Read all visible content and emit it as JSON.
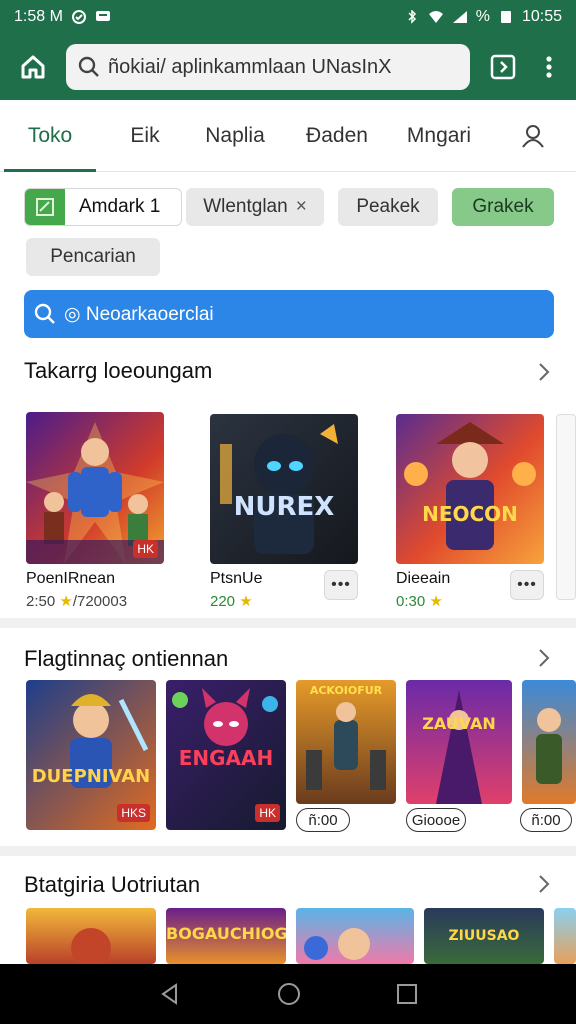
{
  "status_bar": {
    "time_left": "1:58 M",
    "time_right": "10:55",
    "battery": "%"
  },
  "app_bar": {
    "search_text": "ñokiai/ aplinkammlaan UNasInX",
    "home_icon": "home-icon",
    "tabs_icon": "tabs-icon",
    "menu_icon": "more-vertical-icon",
    "color": "#1f6f4a"
  },
  "nav_tabs": [
    {
      "label": "Toko",
      "active": true
    },
    {
      "label": "Eik",
      "active": false
    },
    {
      "label": "Naplia",
      "active": false
    },
    {
      "label": "Ðaden",
      "active": false
    },
    {
      "label": "Mngari",
      "active": false
    }
  ],
  "filter_chips": {
    "first": "Amdark 1",
    "second": "Wlentglan",
    "second_close": "×",
    "third": "Peakek",
    "fourth": "Grakek",
    "fifth": "Pencarian"
  },
  "search_banner": {
    "text": "◎ Neoarkaoerclai"
  },
  "section1": {
    "title": "Takarrg loeoungam",
    "cards": [
      {
        "name": "PoenIRnean",
        "meta": "2:50",
        "rating_text": "/720003",
        "badge": "HK"
      },
      {
        "name": "PtsnUe",
        "meta": "220",
        "art_text": "NUREX"
      },
      {
        "name": "Dieeain",
        "meta": "0:30",
        "art_text": "NEOCON"
      }
    ]
  },
  "section2": {
    "title": "Flagtinnaç ontiennan",
    "cards": [
      {
        "art_text": "DUEPNIVAN",
        "badge": "HKS",
        "price": ""
      },
      {
        "art_text": "ENGAAH",
        "badge": "HK",
        "price": ""
      },
      {
        "art_text": "ACKOIOFUR",
        "price": "ñ:00"
      },
      {
        "art_text": "ZAUVAN",
        "price": "Gioooe"
      },
      {
        "art_text": "",
        "price": "ñ:00"
      }
    ]
  },
  "section3": {
    "title": "Btatgiria Uotriutan",
    "cards": [
      {
        "art_text": ""
      },
      {
        "art_text": "BOGAUCHIOG"
      },
      {
        "art_text": ""
      },
      {
        "art_text": "ZIUUSAO"
      },
      {
        "art_text": ""
      }
    ]
  },
  "colors": {
    "accent": "#1f6f4a",
    "blue": "#2c86e8",
    "chip_green": "#86c989",
    "star": "#e6b800"
  }
}
